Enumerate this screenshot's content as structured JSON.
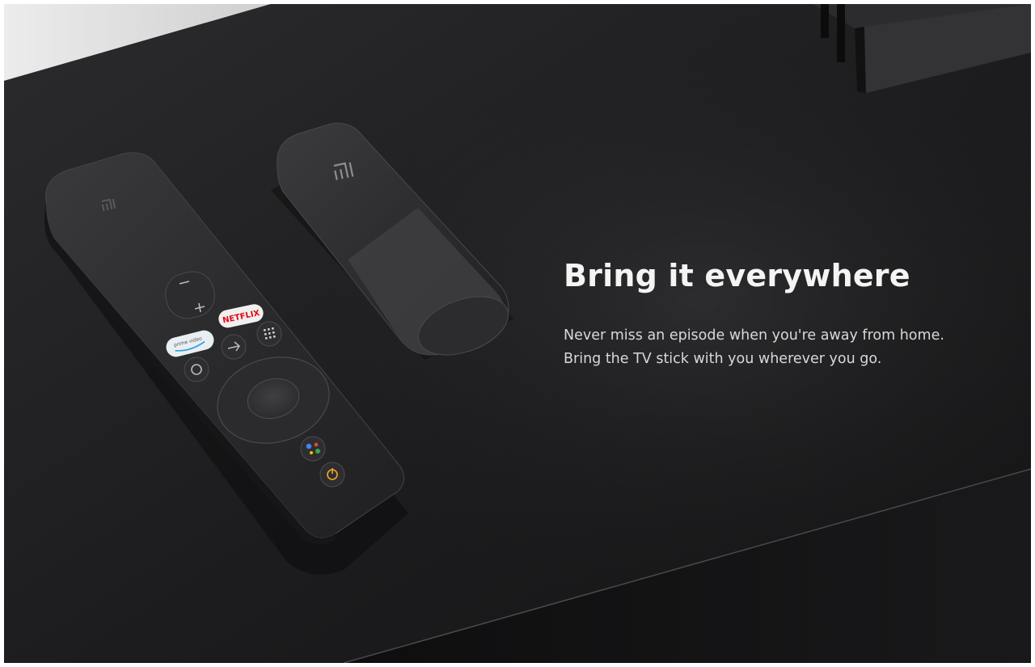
{
  "headline": "Bring it everywhere",
  "body_lines": [
    "Never miss an episode when you're away from home.",
    "Bring the TV stick with you wherever you go."
  ],
  "brand_logo_text": "mi",
  "remote_buttons": {
    "netflix": "NETFLIX",
    "prime_video": "prime video"
  },
  "colors": {
    "table_top": "#1f1f21",
    "wall": "#e3e3e3",
    "device": "#2a2a2c",
    "netflix_red": "#e50914",
    "power_accent": "#f5a623",
    "assistant_blue": "#4285f4",
    "assistant_red": "#ea4335",
    "assistant_yellow": "#fbbc05",
    "assistant_green": "#34a853"
  },
  "icons": [
    "volume-minus-icon",
    "volume-plus-icon",
    "netflix-button",
    "prime-video-button",
    "input-arrow-icon",
    "apps-grid-icon",
    "home-circle-icon",
    "dpad-ring",
    "assistant-icon",
    "power-icon"
  ]
}
